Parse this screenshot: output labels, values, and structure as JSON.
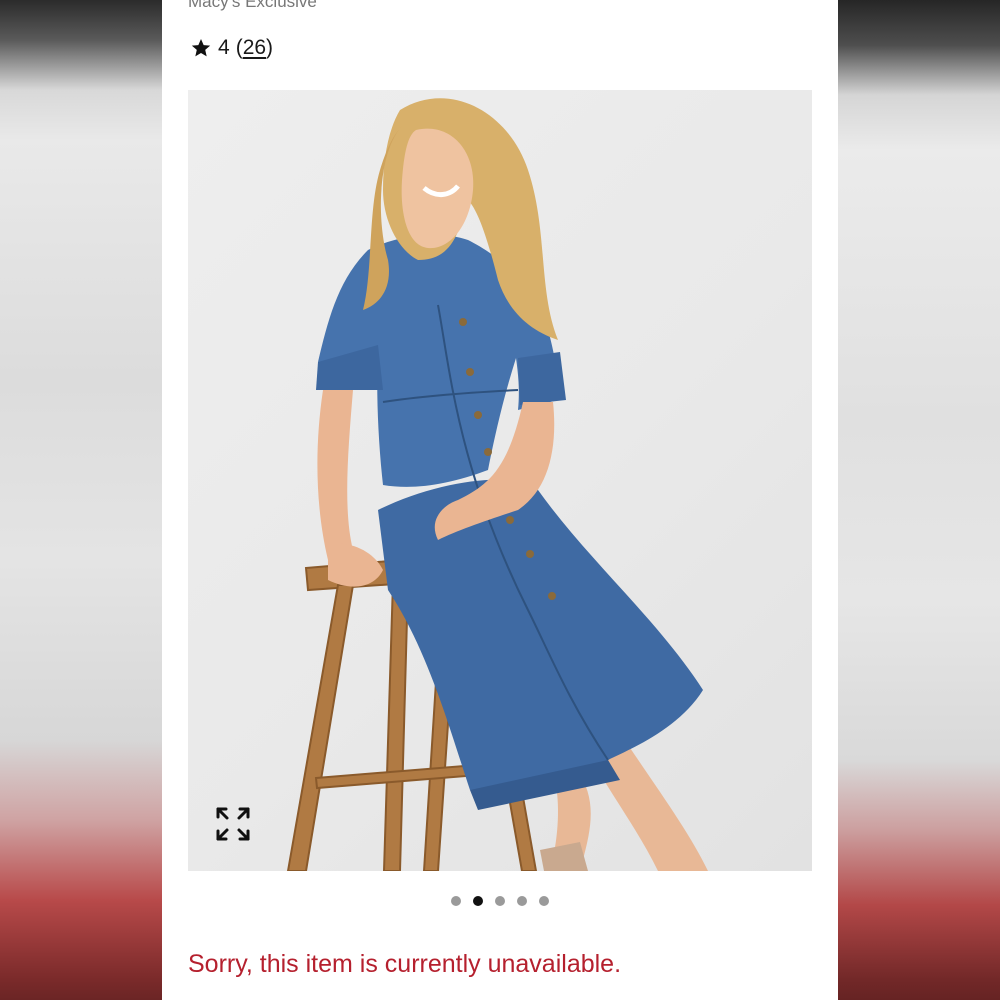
{
  "product": {
    "brand_line": "Macy's Exclusive",
    "rating": {
      "value": "4",
      "review_count": "26",
      "open_paren": "(",
      "close_paren": ")"
    },
    "image": {
      "alt": "Woman wearing a short-sleeve denim midi shirt dress, seated on a wooden stool",
      "expand_icon": "expand-arrows-icon"
    },
    "carousel": {
      "total_slides": 5,
      "active_index": 1
    },
    "availability_message": "Sorry, this item is currently unavailable."
  },
  "colors": {
    "unavailable_text": "#b5202e",
    "dot_active": "#111111",
    "dot_inactive": "#9a9a9a"
  }
}
